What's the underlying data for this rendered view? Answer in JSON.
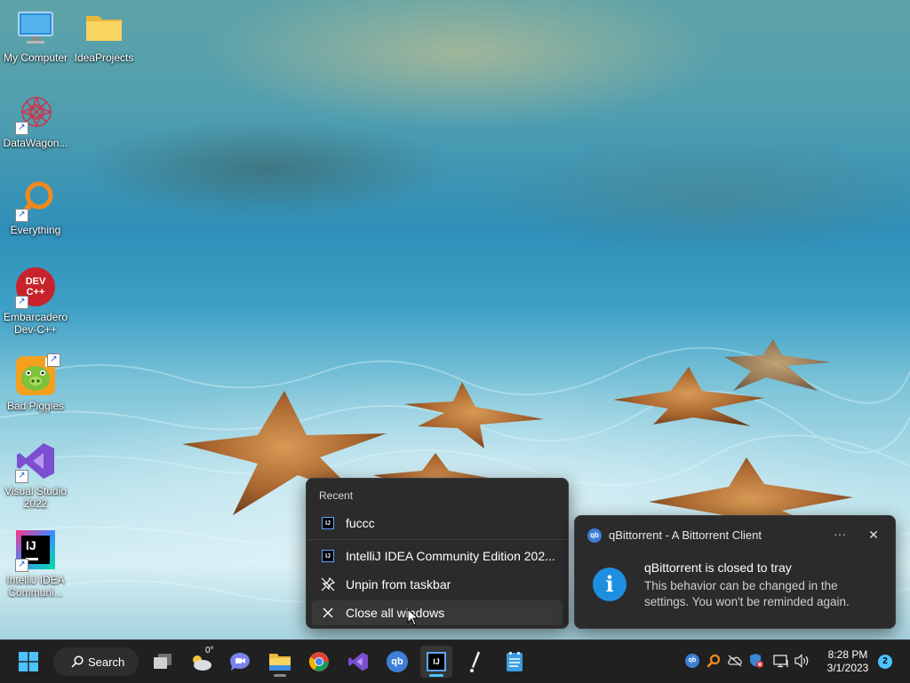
{
  "desktop": {
    "icons": [
      {
        "label": "My Computer",
        "icon": "monitor-icon"
      },
      {
        "label": "IdeaProjects",
        "icon": "folder-icon"
      },
      {
        "label": "DataWagon...",
        "icon": "datawagon-icon"
      },
      {
        "label": "Everything",
        "icon": "everything-search-icon"
      },
      {
        "label": "Embarcadero Dev-C++",
        "icon": "devcpp-icon",
        "badge": "DEV C++"
      },
      {
        "label": "Bad Piggies",
        "icon": "bad-piggies-icon"
      },
      {
        "label": "Visual Studio 2022",
        "icon": "visual-studio-icon"
      },
      {
        "label": "IntelliJ IDEA Communi...",
        "icon": "intellij-icon",
        "badge": "IJ"
      }
    ]
  },
  "jumplist": {
    "header": "Recent",
    "recent": [
      {
        "label": "fuccc",
        "icon": "intellij-icon"
      }
    ],
    "tasks": [
      {
        "label": "IntelliJ IDEA Community Edition 202...",
        "icon": "intellij-icon"
      },
      {
        "label": "Unpin from taskbar",
        "icon": "unpin-icon"
      },
      {
        "label": "Close all windows",
        "icon": "close-icon"
      }
    ]
  },
  "toast": {
    "app_icon": "qb",
    "app_name": "qBittorrent - A Bittorrent Client",
    "more": "···",
    "close": "✕",
    "info_glyph": "i",
    "title": "qBittorrent is closed to tray",
    "body": "This behavior can be changed in the settings. You won't be reminded again."
  },
  "taskbar": {
    "search_label": "Search",
    "weather_temp": "0°",
    "tray_qb": "qb",
    "time": "8:28 PM",
    "date": "3/1/2023",
    "notification_count": "2",
    "intellij_badge": "IJ"
  },
  "colors": {
    "taskbar_bg": "#202020",
    "flyout_bg": "#2b2b2b",
    "accent": "#4cc2ff",
    "info_blue": "#1e8fe0"
  }
}
